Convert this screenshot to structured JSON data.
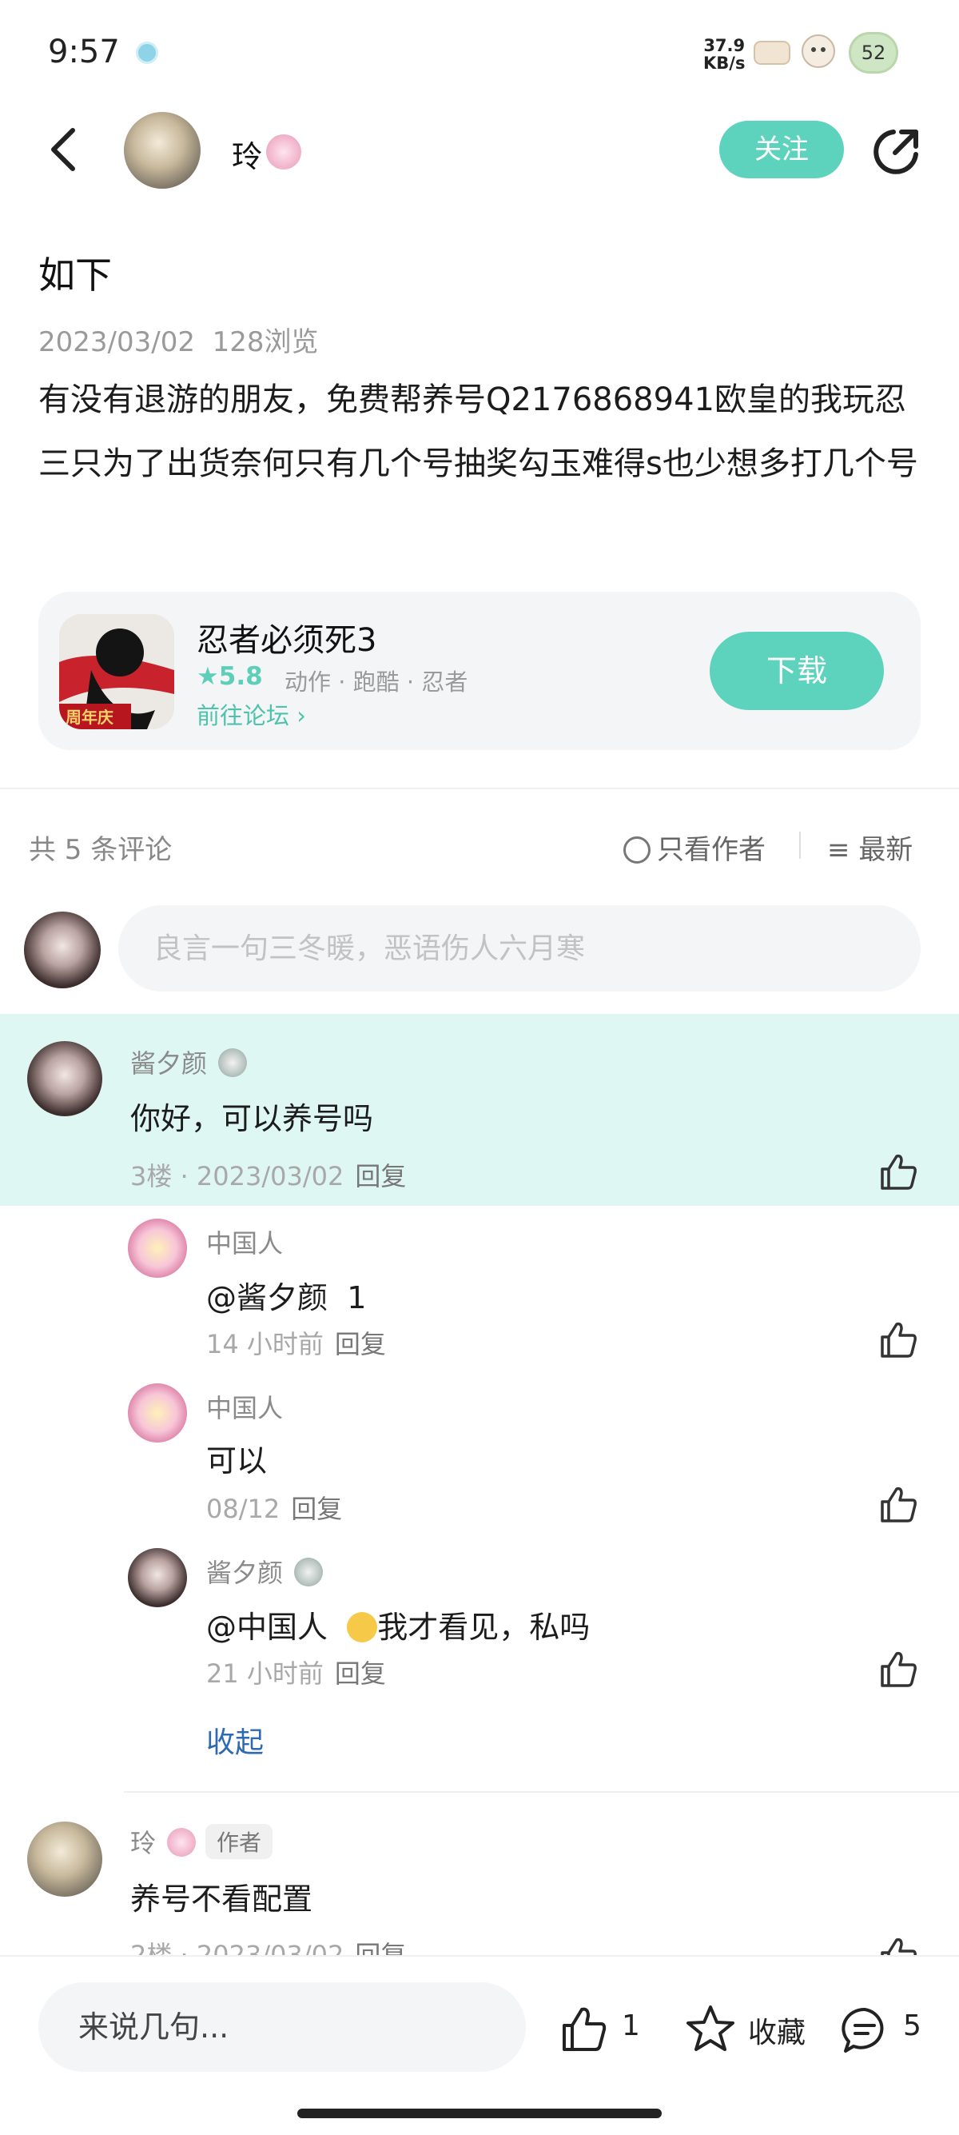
{
  "status_bar": {
    "time": "9:57",
    "net_speed_value": "37.9",
    "net_speed_unit": "KB/s",
    "battery": "52"
  },
  "header": {
    "author_name": "玲",
    "follow_label": "关注"
  },
  "post": {
    "title": "如下",
    "date": "2023/03/02",
    "views": "128浏览",
    "body": "有没有退游的朋友，免费帮养号Q2176868941欧皇的我玩忍三只为了出货奈何只有几个号抽奖勾玉难得s也少想多打几个号"
  },
  "game_card": {
    "name": "忍者必须死3",
    "rating": "5.8",
    "tags": [
      "动作",
      "跑酷",
      "忍者"
    ],
    "tag_separator": " · ",
    "forum_link": "前往论坛",
    "download_label": "下载",
    "icon_badge": "周年庆",
    "accent": "#5dd3bd"
  },
  "comments_header": {
    "count_label": "共 5 条评论",
    "author_only_label": "只看作者",
    "sort_label": "最新",
    "input_placeholder": "良言一句三冬暖，恶语伤人六月寒"
  },
  "comments": [
    {
      "name": "酱夕颜",
      "text": "你好，可以养号吗",
      "floor": "3楼",
      "date": "2023/03/02",
      "reply_label": "回复",
      "replies": [
        {
          "name": "中国人",
          "mention": "@酱夕颜",
          "text": "1",
          "time": "14 小时前",
          "reply_label": "回复"
        },
        {
          "name": "中国人",
          "text": "可以",
          "time": "08/12",
          "reply_label": "回复"
        },
        {
          "name": "酱夕颜",
          "mention": "@中国人",
          "text": "我才看见，私吗",
          "time": "21 小时前",
          "reply_label": "回复"
        }
      ],
      "collapse_label": "收起"
    },
    {
      "name": "玲",
      "author_tag": "作者",
      "text": "养号不看配置",
      "floor": "2楼",
      "date": "2023/03/02",
      "reply_label": "回复"
    }
  ],
  "bottom_bar": {
    "input_placeholder": "来说几句...",
    "like_count": "1",
    "collect_label": "收藏",
    "comment_count": "5"
  }
}
